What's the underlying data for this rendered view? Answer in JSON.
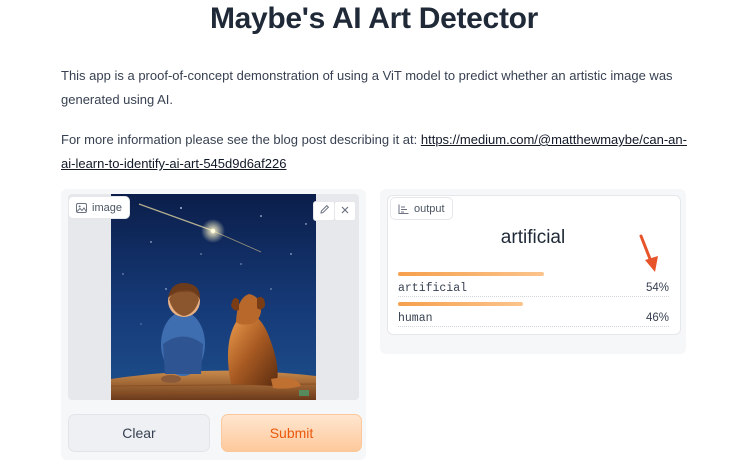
{
  "page": {
    "title": "Maybe's AI Art Detector",
    "description": "This app is a proof-of-concept demonstration of using a ViT model to predict whether an artistic image was generated using AI.",
    "more_info_prefix": "For more information please see the blog post describing it at: ",
    "blog_link": "https://medium.com/@matthewmaybe/can-an-ai-learn-to-identify-ai-art-545d9d6af226"
  },
  "input": {
    "chip_label": "image",
    "clear_label": "Clear",
    "submit_label": "Submit"
  },
  "output": {
    "chip_label": "output",
    "predicted_label": "artificial",
    "confidences": [
      {
        "label": "artificial",
        "percent_text": "54%",
        "value": 0.54
      },
      {
        "label": "human",
        "percent_text": "46%",
        "value": 0.46
      }
    ]
  },
  "colors": {
    "accent": "#ea580c",
    "bar": "#f6a04d",
    "annotation_arrow": "#e8542a"
  }
}
